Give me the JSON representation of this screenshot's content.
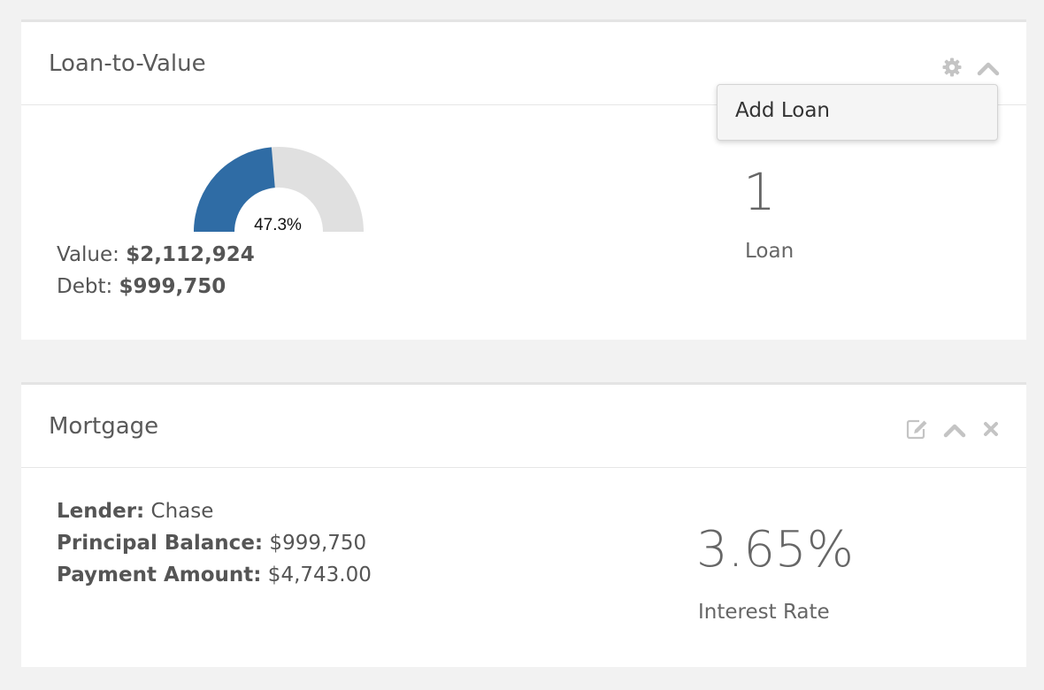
{
  "ltv_panel": {
    "title": "Loan-to-Value",
    "gauge": {
      "percent_label": "47.3%",
      "fraction": 0.473,
      "fill_color": "#2f6ca5",
      "track_color": "#e0e0e0"
    },
    "value_label": "Value: ",
    "value_amount": "$2,112,924",
    "debt_label": "Debt: ",
    "debt_amount": "$999,750",
    "loan_count": "1",
    "loan_count_label": "Loan",
    "menu": {
      "items": [
        {
          "label": "Add Loan"
        }
      ]
    },
    "icons": [
      "gear-icon",
      "chevron-up-icon"
    ]
  },
  "mortgage_panel": {
    "title": "Mortgage",
    "lender_label": "Lender:",
    "lender_value": " Chase",
    "principal_label": "Principal Balance:",
    "principal_value": " $999,750",
    "payment_label": "Payment Amount:",
    "payment_value": " $4,743.00",
    "interest_rate": "3.65%",
    "interest_rate_label": "Interest Rate",
    "icons": [
      "edit-icon",
      "chevron-up-icon",
      "close-icon"
    ]
  }
}
